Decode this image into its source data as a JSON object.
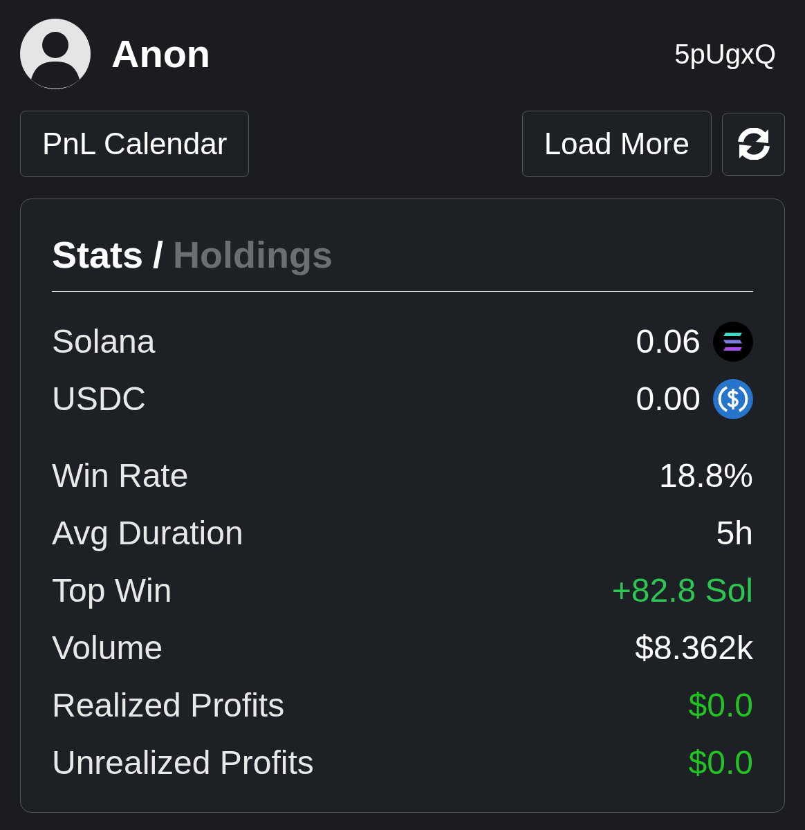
{
  "profile": {
    "name": "Anon",
    "address": "5pUgxQ"
  },
  "buttons": [
    {
      "kind": "text",
      "label": "PnL Calendar"
    },
    {
      "kind": "text",
      "label": "Load More"
    },
    {
      "kind": "refresh"
    }
  ],
  "tabs": [
    {
      "label": "Stats",
      "selected": true
    },
    {
      "label": "Holdings",
      "selected": false
    }
  ],
  "tab_separator": "/",
  "balances": [
    {
      "label": "Solana",
      "value": "0.06",
      "kind": "solana"
    },
    {
      "label": "USDC",
      "value": "0.00",
      "kind": "usdc"
    }
  ],
  "stats": [
    {
      "label": "Win Rate",
      "value": "18.8%",
      "color": "#ffffff"
    },
    {
      "label": "Avg Duration",
      "value": "5h",
      "color": "#ffffff"
    },
    {
      "label": "Top Win",
      "value": "+82.8 Sol",
      "color": "#2dc653"
    },
    {
      "label": "Volume",
      "value": "$8.362k",
      "color": "#ffffff"
    },
    {
      "label": "Realized Profits",
      "value": "$0.0",
      "color": "#22c322"
    },
    {
      "label": "Unrealized Profits",
      "value": "$0.0",
      "color": "#22c322"
    }
  ]
}
